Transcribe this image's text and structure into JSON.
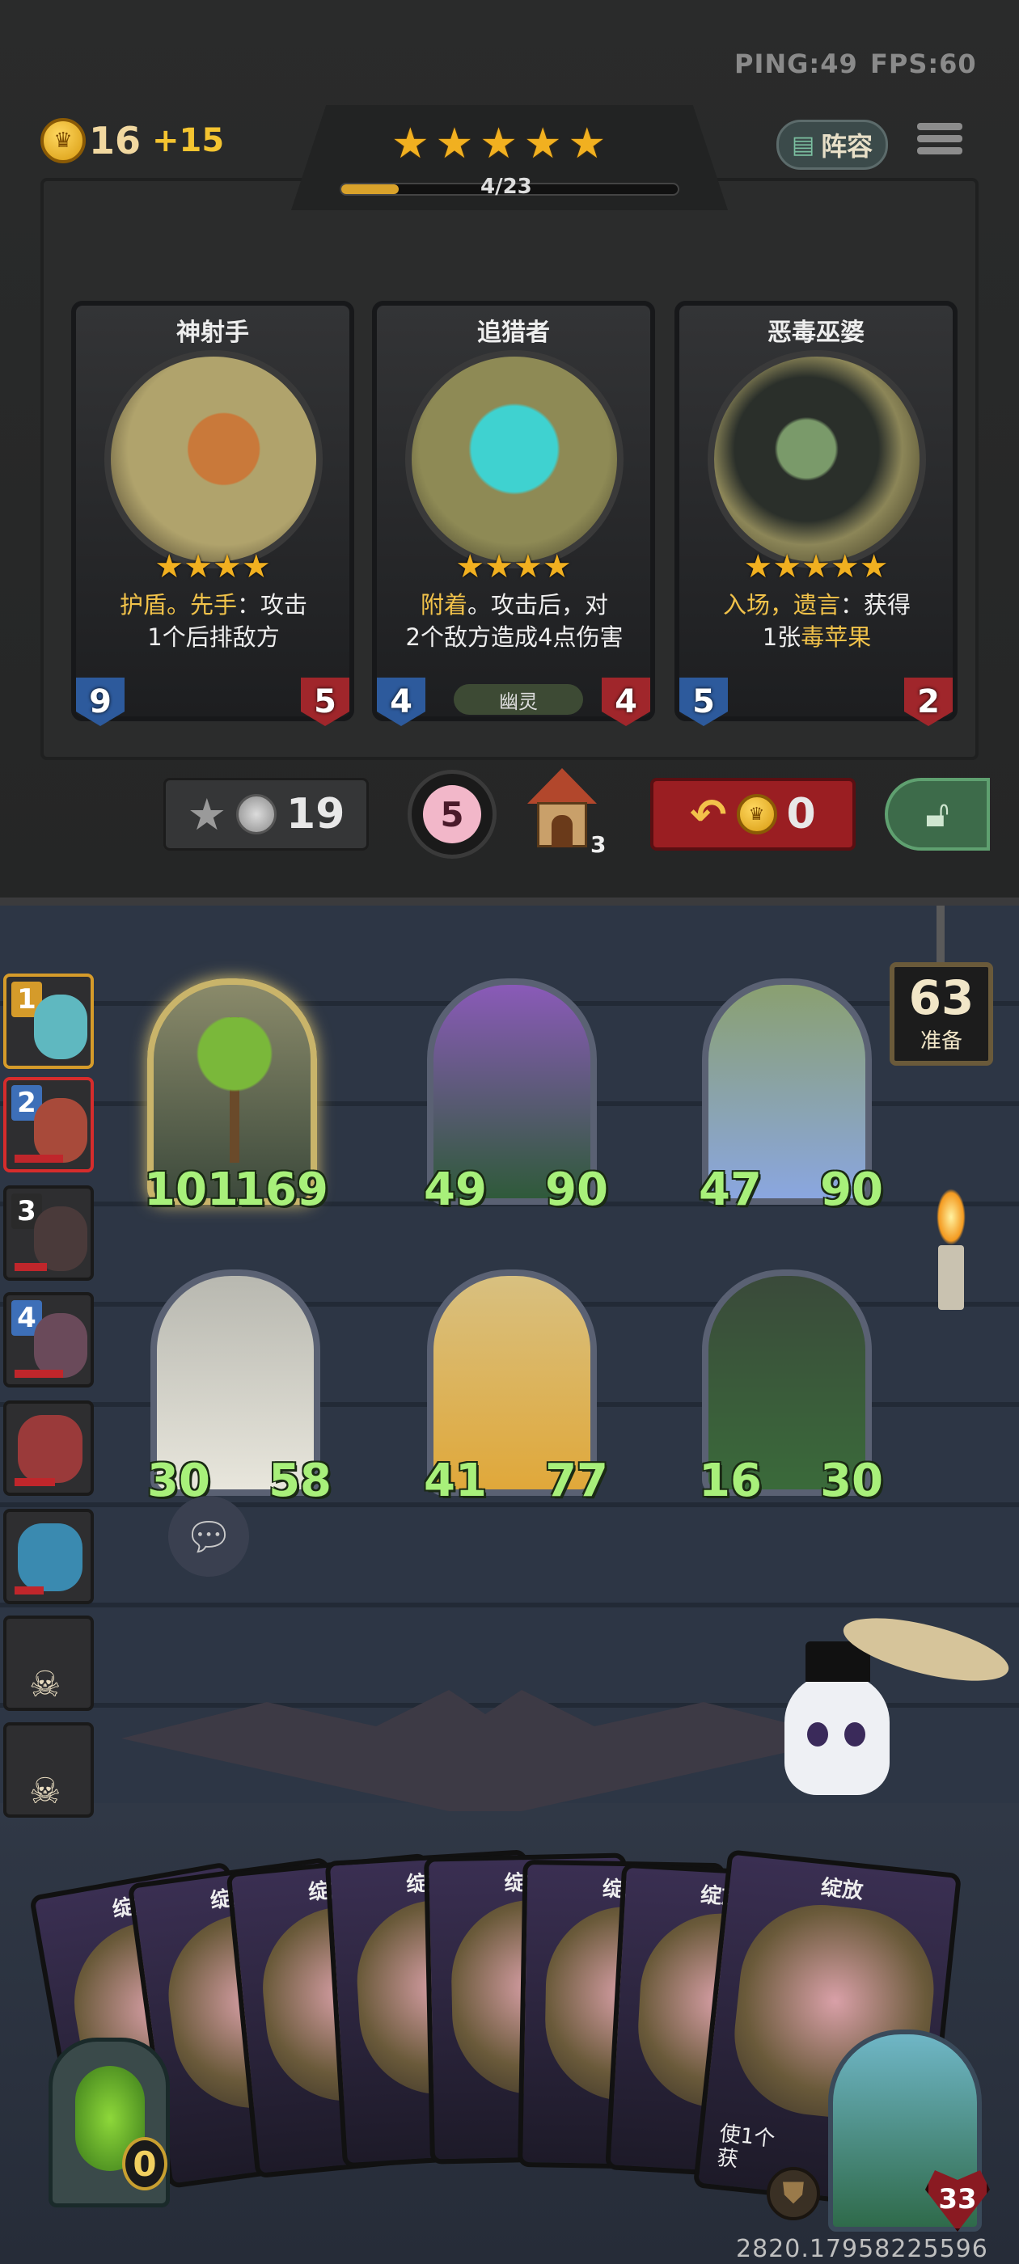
{
  "header": {
    "ping": "PING:49",
    "fps": "FPS:60",
    "gold": "16",
    "gold_income": "+15",
    "tier_progress": "4/23",
    "tier_progress_value": 0.17,
    "tier_stars": 5,
    "lineup_label": "阵容"
  },
  "shop_cards": [
    {
      "name": "神射手",
      "stars": 4,
      "desc_parts": [
        [
          "护盾。先手",
          true
        ],
        [
          "：攻击",
          false
        ],
        [
          "1个后排敌方",
          false
        ]
      ],
      "attack": "9",
      "health": "5",
      "tribe": ""
    },
    {
      "name": "追猎者",
      "stars": 4,
      "desc_parts": [
        [
          "附着",
          true
        ],
        [
          "。攻击后，对",
          false
        ],
        [
          "2个敌方造成4点伤害",
          false
        ]
      ],
      "attack": "4",
      "health": "4",
      "tribe": "幽灵"
    },
    {
      "name": "恶毒巫婆",
      "stars": 5,
      "desc_parts": [
        [
          "入场，遗言",
          true
        ],
        [
          "：获得",
          false
        ],
        [
          "1张",
          false
        ],
        [
          "毒苹果",
          true
        ]
      ],
      "attack": "5",
      "health": "2",
      "tribe": ""
    }
  ],
  "shop_actions": {
    "upgrade_cost": "19",
    "tavern_tier": "5",
    "house_count": "3",
    "refresh_cost": "0"
  },
  "board": {
    "ready_count": "63",
    "ready_label": "准备",
    "minions": [
      {
        "atk": "101",
        "hp": "169"
      },
      {
        "atk": "49",
        "hp": "90"
      },
      {
        "atk": "47",
        "hp": "90"
      },
      {
        "atk": "30",
        "hp": "58"
      },
      {
        "atk": "41",
        "hp": "77"
      },
      {
        "atk": "16",
        "hp": "30"
      }
    ]
  },
  "roster": [
    "1",
    "2",
    "3",
    "4"
  ],
  "hand": {
    "cards": [
      "绽放",
      "绽放",
      "绽放",
      "绽放",
      "绽放",
      "绽放",
      "绽放",
      "绽放"
    ],
    "front_card_text": "使1个\n获"
  },
  "player": {
    "health": "33",
    "resource": "0",
    "coords_text": "2820.17958225596"
  },
  "colors": {
    "gold": "#f1b020",
    "keyword": "#f1c24a",
    "stat_text": "#a8f07a"
  }
}
